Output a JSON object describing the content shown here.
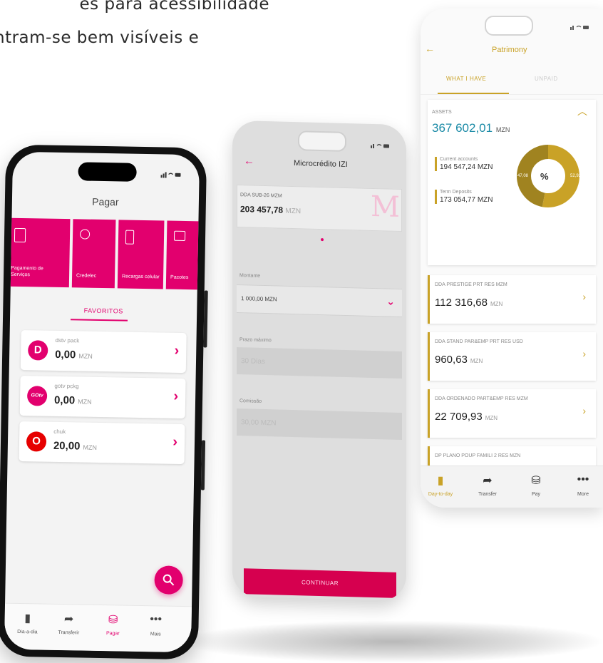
{
  "headline": {
    "line1": "es para acessibilidade",
    "line2": "ntram-se bem visíveis e"
  },
  "phone_pagar": {
    "status": "▐▾ ▬",
    "title": "Pagar",
    "categories": [
      {
        "label": "Pagamento de Serviços",
        "icon": "document-icon"
      },
      {
        "label": "Credelec",
        "icon": "bulb-icon"
      },
      {
        "label": "Recargas celular",
        "icon": "phone-icon"
      },
      {
        "label": "Pacotes",
        "icon": "tv-icon"
      }
    ],
    "favorites_title": "FAVORITOS",
    "favorites": [
      {
        "name": "dstv pack",
        "logo": "D",
        "amount": "0,00",
        "currency": "MZN"
      },
      {
        "name": "gotv pckg",
        "logo": "GOtv",
        "amount": "0,00",
        "currency": "MZN"
      },
      {
        "name": "chuk",
        "logo": "O",
        "amount": "20,00",
        "currency": "MZN"
      }
    ],
    "fab_icon": "search-icon",
    "tabs": [
      {
        "label": "Dia-a-dia",
        "icon": "wallet-icon"
      },
      {
        "label": "Transferir",
        "icon": "arrow-icon"
      },
      {
        "label": "Pagar",
        "icon": "coins-icon",
        "active": true
      },
      {
        "label": "Mais",
        "icon": "more-icon"
      }
    ]
  },
  "phone_microcredito": {
    "title": "Microcrédito IZI",
    "account_name": "DDA SUB-26 MZM",
    "account_value": "203 457,78",
    "account_currency": "MZN",
    "watermark": "M",
    "montante_label": "Montante",
    "montante_value": "1 000,00 MZN",
    "prazo_label": "Prazo máximo",
    "prazo_value": "30 Dias",
    "comissao_label": "Comissão",
    "comissao_value": "30,00 MZN",
    "cta": "CONTINUAR"
  },
  "phone_patrimony": {
    "title": "Patrimony",
    "tab_active": "WHAT I HAVE",
    "tab_inactive": "UNPAID",
    "assets_label": "ASSETS",
    "assets_total": "367 602,01",
    "assets_currency": "MZN",
    "current_label": "Current accounts",
    "current_value": "194 547,24 MZN",
    "term_label": "Term Deposits",
    "term_value": "173 054,77 MZN",
    "donut_center": "%",
    "donut_left": "47,08",
    "donut_right": "52,92",
    "accounts": [
      {
        "name": "DDA PRESTIGE PRT RES MZM",
        "value": "112 316,68",
        "currency": "MZN"
      },
      {
        "name": "DDA STAND PAR&EMP PRT RES USD",
        "value": "960,63",
        "currency": "MZN"
      },
      {
        "name": "DDA ORDENADO PART&EMP RES MZM",
        "value": "22 709,93",
        "currency": "MZN"
      },
      {
        "name": "DP PLANO POUP FAMILI 2 RES MZN",
        "value": "",
        "currency": ""
      }
    ],
    "tabs": [
      {
        "label": "Day-to-day",
        "icon": "wallet-icon",
        "active": true
      },
      {
        "label": "Transfer",
        "icon": "arrow-icon"
      },
      {
        "label": "Pay",
        "icon": "coins-icon"
      },
      {
        "label": "More",
        "icon": "more-icon"
      }
    ],
    "chart_data": {
      "type": "pie",
      "categories": [
        "Current accounts",
        "Term Deposits"
      ],
      "values": [
        52.92,
        47.08
      ]
    }
  },
  "colors": {
    "magenta": "#e2006e",
    "gold": "#c9a227",
    "teal": "#1a8aa6"
  }
}
